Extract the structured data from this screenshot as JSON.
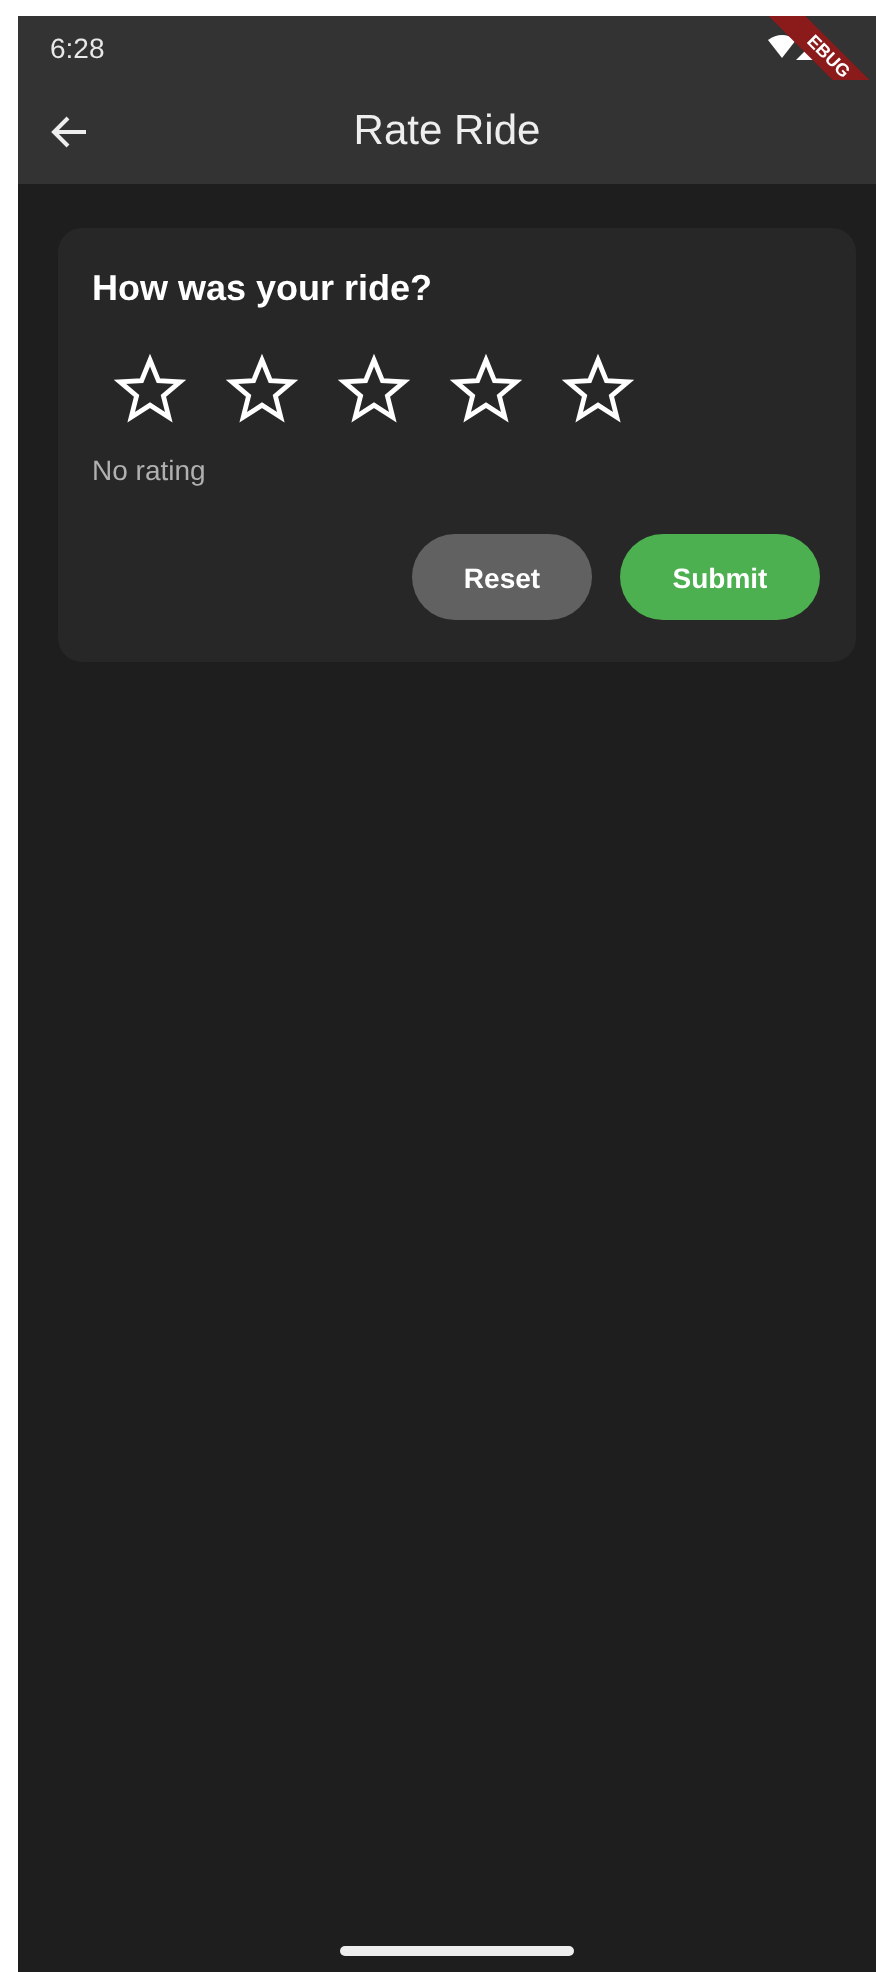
{
  "status_bar": {
    "time": "6:28",
    "debug_banner": "EBUG"
  },
  "app_bar": {
    "title": "Rate Ride"
  },
  "card": {
    "title": "How was your ride?",
    "stars": 0,
    "rating_text": "No rating",
    "buttons": [
      {
        "label": "Reset",
        "kind": "secondary"
      },
      {
        "label": "Submit",
        "kind": "primary"
      }
    ]
  }
}
